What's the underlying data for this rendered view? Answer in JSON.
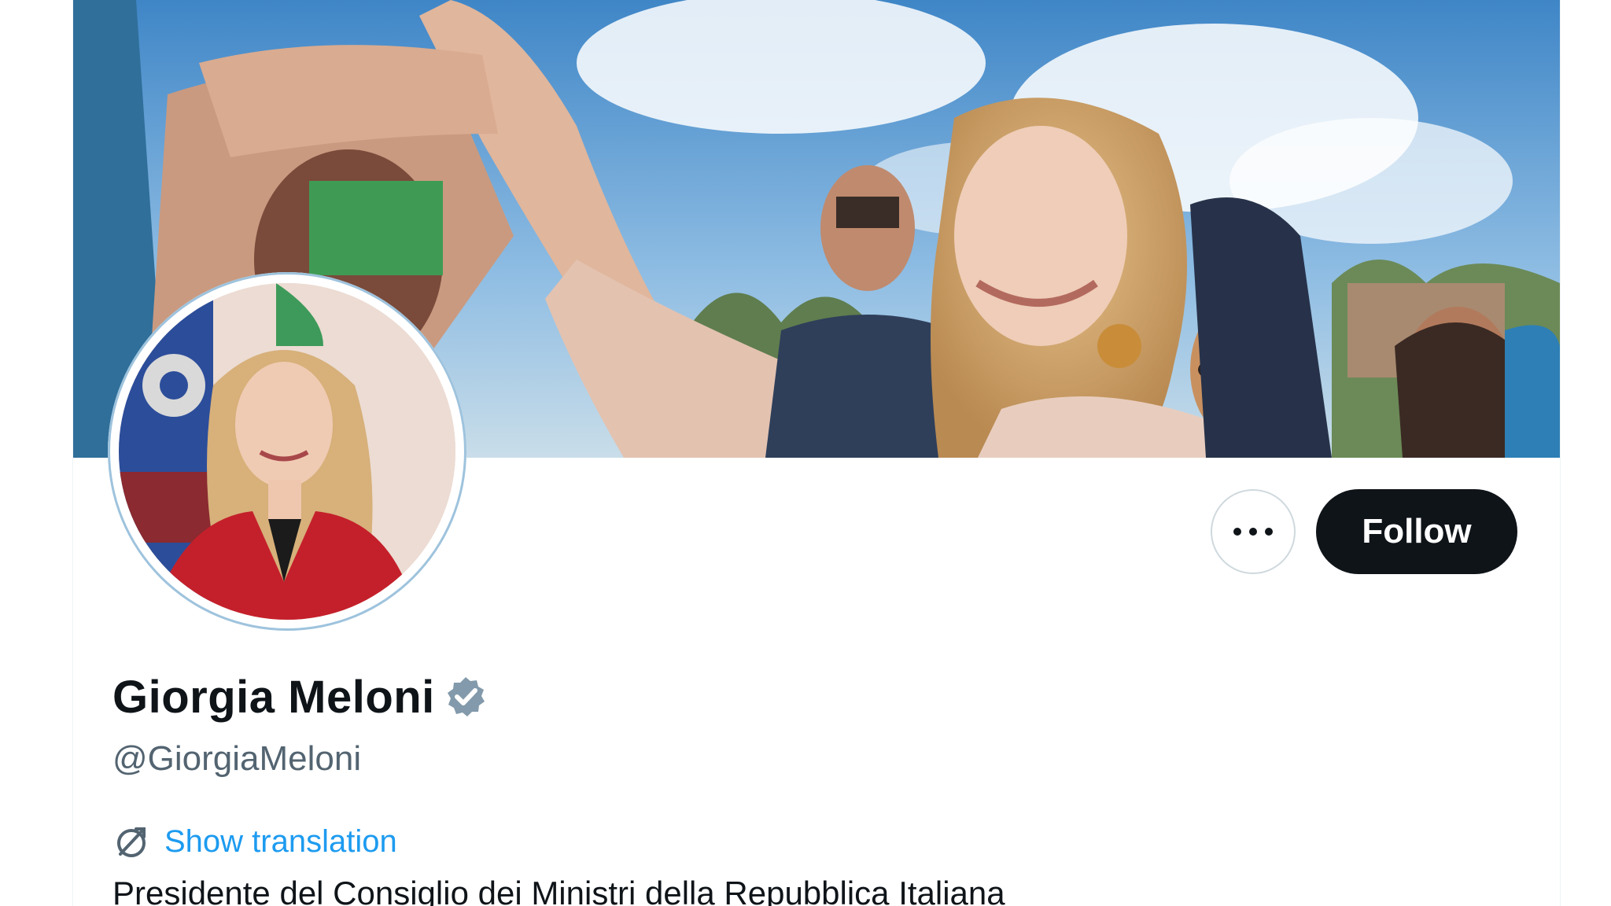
{
  "profile": {
    "display_name": "Giorgia Meloni",
    "handle": "@GiorgiaMeloni",
    "verified": true,
    "bio": "Presidente del Consiglio dei Ministri della Repubblica Italiana"
  },
  "actions": {
    "follow_label": "Follow",
    "more_icon": "more-horizontal-icon"
  },
  "translation": {
    "label": "Show translation",
    "icon": "translate-icon"
  },
  "colors": {
    "primary_text": "#0f1419",
    "secondary_text": "#536471",
    "link": "#1d9bf0",
    "follow_button_bg": "#0f1419",
    "verified_badge": "#829aab"
  }
}
